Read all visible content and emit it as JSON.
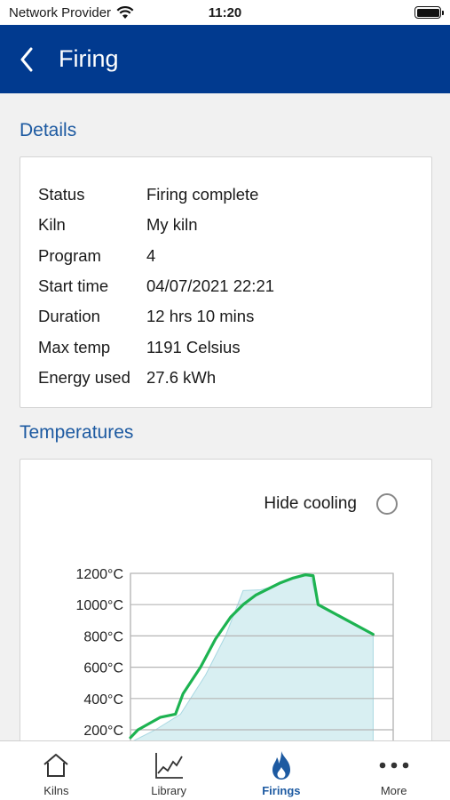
{
  "status_bar": {
    "carrier": "Network Provider",
    "time": "11:20"
  },
  "nav": {
    "title": "Firing"
  },
  "details": {
    "section_title": "Details",
    "rows": [
      {
        "label": "Status",
        "value": "Firing complete"
      },
      {
        "label": "Kiln",
        "value": "My kiln"
      },
      {
        "label": "Program",
        "value": "4"
      },
      {
        "label": "Start time",
        "value": "04/07/2021 22:21"
      },
      {
        "label": "Duration",
        "value": "12 hrs 10 mins"
      },
      {
        "label": "Max temp",
        "value": "1191 Celsius"
      },
      {
        "label": "Energy used",
        "value": "27.6 kWh"
      }
    ]
  },
  "temperatures": {
    "section_title": "Temperatures",
    "hide_cooling_label": "Hide cooling",
    "hide_cooling_checked": false
  },
  "chart_data": {
    "type": "area",
    "y_unit": "°C",
    "ylim": [
      200,
      1200
    ],
    "yticks": [
      "1200°C",
      "1000°C",
      "800°C",
      "600°C",
      "400°C",
      "200°C"
    ],
    "grid": true,
    "colors": {
      "actual": "#1db351",
      "program_fill": "#d8eff2",
      "program_line": "#a9d8e2"
    },
    "series": [
      {
        "role": "program",
        "x": [
          0,
          1,
          2,
          3,
          3.8,
          4.5,
          5.2,
          5.8,
          6.4,
          7.0,
          7.2,
          7.5,
          9.7,
          9.7
        ],
        "y": [
          120,
          200,
          300,
          550,
          800,
          1090,
          1095,
          1120,
          1160,
          1185,
          1180,
          1000,
          810,
          0
        ]
      },
      {
        "role": "actual",
        "x": [
          0.0,
          0.3,
          1.2,
          1.8,
          2.1,
          2.8,
          3.4,
          4.0,
          4.5,
          5.0,
          5.5,
          6.0,
          6.5,
          7.0,
          7.3,
          7.5,
          9.7
        ],
        "y": [
          150,
          200,
          280,
          300,
          430,
          600,
          780,
          920,
          1000,
          1060,
          1100,
          1140,
          1170,
          1191,
          1185,
          1000,
          810
        ]
      }
    ]
  },
  "tabs": [
    {
      "label": "Kilns",
      "icon": "house-icon",
      "active": false
    },
    {
      "label": "Library",
      "icon": "chart-icon",
      "active": false
    },
    {
      "label": "Firings",
      "icon": "flame-icon",
      "active": true
    },
    {
      "label": "More",
      "icon": "ellipsis-icon",
      "active": false
    }
  ]
}
